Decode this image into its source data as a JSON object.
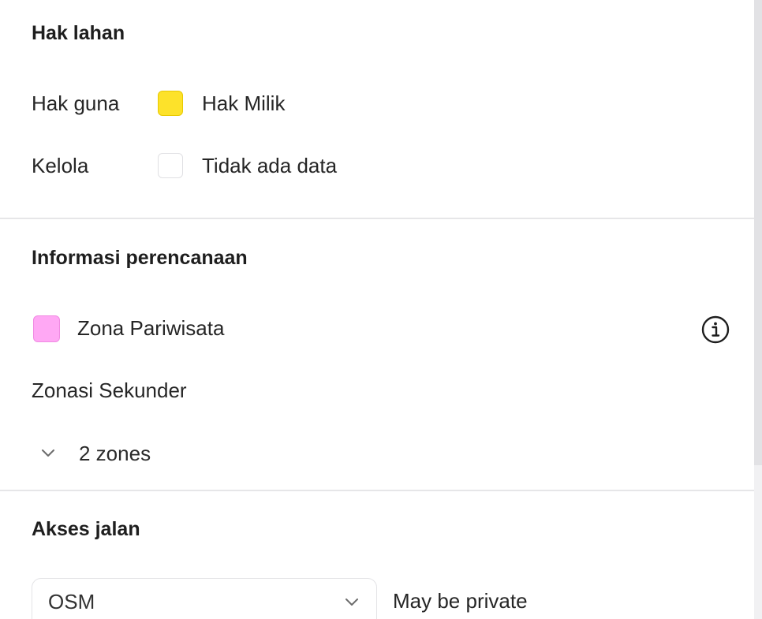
{
  "hak_lahan": {
    "heading": "Hak lahan",
    "rows": [
      {
        "label": "Hak guna",
        "swatch_color": "#fde22a",
        "value": "Hak Milik"
      },
      {
        "label": "Kelola",
        "swatch_color": "#ffffff",
        "value": "Tidak ada data"
      }
    ]
  },
  "informasi_perencanaan": {
    "heading": "Informasi perencanaan",
    "zone": {
      "swatch_color": "#ffa8f4",
      "label": "Zona Pariwisata",
      "icon": "info-icon"
    },
    "secondary_heading": "Zonasi Sekunder",
    "expander": {
      "icon": "chevron-down-icon",
      "label": "2 zones"
    }
  },
  "akses_jalan": {
    "heading": "Akses jalan",
    "select": {
      "value": "OSM",
      "icon": "chevron-down-icon"
    },
    "status": "May be private"
  }
}
